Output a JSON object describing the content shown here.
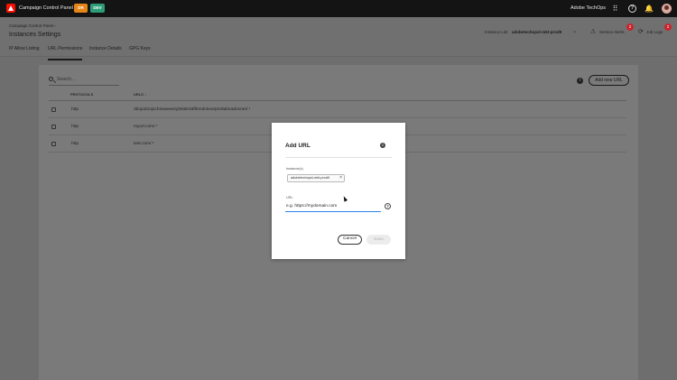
{
  "topbar": {
    "app_title": "Campaign Control Panel",
    "env_badges": [
      "DR",
      "DEV"
    ],
    "org_name": "Adobe TechOps",
    "icons": [
      "adobe-logo-icon",
      "apps-grid-icon",
      "help-icon",
      "bell-icon",
      "user-avatar"
    ]
  },
  "header": {
    "breadcrumb": "Campaign Control Panel  ›",
    "title": "Instances Settings",
    "tabs": [
      {
        "label": "IP Allow Listing",
        "active": false
      },
      {
        "label": "URL Permissions",
        "active": true
      },
      {
        "label": "Instance Details",
        "active": false
      },
      {
        "label": "GPG Keys",
        "active": false
      }
    ],
    "instance_list_label": "Instance List",
    "instance_list_value": "adobetechopsl-mkt-prod9",
    "service_alerts_label": "Service Alerts",
    "service_alerts_count": "2",
    "job_logs_label": "Job Logs",
    "job_logs_count": "2"
  },
  "toolbar": {
    "search_placeholder": "Search...",
    "add_button_label": "Add new URL"
  },
  "table": {
    "columns": [
      "PROTOCOLS",
      "URLS ↓"
    ],
    "rows": [
      {
        "protocol": "http",
        "url": "3bojo22ojoch4wwwe2yb5ide33fihmdc5oorpro9aloradocnet/.*"
      },
      {
        "protocol": "http",
        "url": "myurl.com/.*"
      },
      {
        "protocol": "http",
        "url": "test.com/.*"
      }
    ]
  },
  "modal": {
    "title": "Add URL",
    "instances_label": "Instance(s)",
    "instance_tag": "adobetechopsl-mkt-prod9",
    "url_label": "URL",
    "url_placeholder": "e.g. https://mydomain.com",
    "cancel_label": "Cancel",
    "save_label": "Save"
  }
}
